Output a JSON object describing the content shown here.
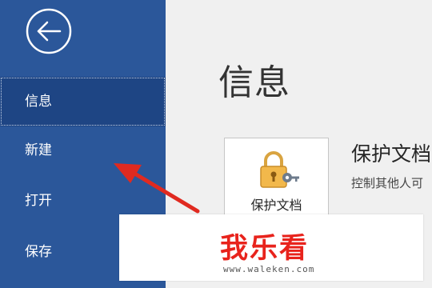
{
  "sidebar": {
    "back_icon": "back-arrow-icon",
    "items": [
      {
        "label": "信息",
        "active": true
      },
      {
        "label": "新建",
        "active": false
      },
      {
        "label": "打开",
        "active": false
      },
      {
        "label": "保存",
        "active": false
      }
    ]
  },
  "main": {
    "title": "信息",
    "protect": {
      "button_label": "保护文档",
      "icon": "lock-key-icon",
      "heading": "保护文档",
      "description": "控制其他人可"
    }
  },
  "watermark": {
    "logo_text": "我乐看",
    "url": "www.waleken.com"
  },
  "annotation": {
    "type": "arrow",
    "color": "#e02a20",
    "points_to": "新建"
  },
  "colors": {
    "sidebar_bg": "#2b579a",
    "sidebar_active": "#1e4584",
    "main_bg": "#f0f0f0",
    "accent_red": "#e8231c"
  }
}
